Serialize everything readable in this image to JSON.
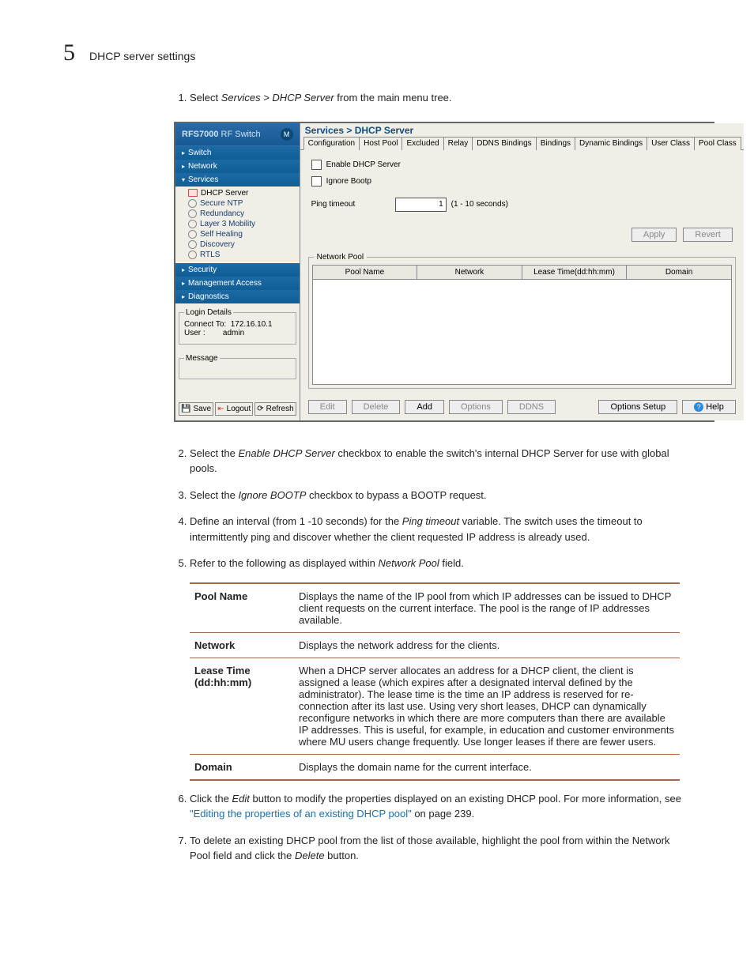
{
  "header": {
    "page_num": "5",
    "title": "DHCP server settings"
  },
  "steps": {
    "s1_pre": "Select ",
    "s1_em": "Services > DHCP Server",
    "s1_post": " from the main menu tree.",
    "s2_pre": "Select the ",
    "s2_em": "Enable DHCP Server",
    "s2_post": " checkbox to enable the switch's internal DHCP Server for use with global pools.",
    "s3_pre": "Select the ",
    "s3_em": "Ignore BOOTP",
    "s3_post": " checkbox to bypass a BOOTP request.",
    "s4_pre": "Define an interval (from 1 -10 seconds) for the ",
    "s4_em": "Ping timeout",
    "s4_post": " variable. The switch uses the timeout to intermittently ping and discover whether the client requested IP address is already used.",
    "s5_pre": "Refer to the following as displayed within ",
    "s5_em": "Network Pool",
    "s5_post": " field.",
    "s6_pre": "Click the ",
    "s6_em": "Edit",
    "s6_mid": " button to modify the properties displayed on an existing DHCP pool. For more information, see ",
    "s6_link": "\"Editing the properties of an existing DHCP pool\"",
    "s6_post": " on page 239.",
    "s7_pre": "To delete an existing DHCP pool from the list of those available, highlight the pool from within the Network Pool field and click the ",
    "s7_em": "Delete",
    "s7_post": " button."
  },
  "ui": {
    "brand_a": "RFS7000",
    "brand_b": " RF Switch",
    "nav": {
      "switch": "Switch",
      "network": "Network",
      "services": "Services",
      "dhcp": "DHCP Server",
      "ntp": "Secure NTP",
      "red": "Redundancy",
      "l3": "Layer 3 Mobility",
      "sh": "Self Healing",
      "disc": "Discovery",
      "rtls": "RTLS",
      "security": "Security",
      "mgmt": "Management Access",
      "diag": "Diagnostics"
    },
    "login": {
      "legend": "Login Details",
      "ct_label": "Connect To:",
      "ct_val": "172.16.10.1",
      "u_label": "User :",
      "u_val": "admin"
    },
    "msg_legend": "Message",
    "footer": {
      "save": "Save",
      "logout": "Logout",
      "refresh": "Refresh"
    },
    "bc": "Services > DHCP Server",
    "tabs": [
      "Configuration",
      "Host Pool",
      "Excluded",
      "Relay",
      "DDNS Bindings",
      "Bindings",
      "Dynamic Bindings",
      "User Class",
      "Pool Class"
    ],
    "form": {
      "enable": "Enable DHCP Server",
      "ignore": "Ignore Bootp",
      "ping": "Ping timeout",
      "ping_val": "1",
      "ping_hint": "(1 - 10 seconds)"
    },
    "actions": {
      "apply": "Apply",
      "revert": "Revert"
    },
    "np_legend": "Network Pool",
    "np_cols": [
      "Pool Name",
      "Network",
      "Lease Time(dd:hh:mm)",
      "Domain"
    ],
    "np_btns": {
      "edit": "Edit",
      "delete": "Delete",
      "add": "Add",
      "options": "Options",
      "ddns": "DDNS",
      "osetup": "Options Setup",
      "help": "Help"
    }
  },
  "table": {
    "r1k": "Pool Name",
    "r1v": "Displays the name of the IP pool from which IP addresses can be issued to DHCP client requests on the current interface. The pool is the range of IP addresses available.",
    "r2k": "Network",
    "r2v": "Displays the network address for the clients.",
    "r3k": "Lease Time (dd:hh:mm)",
    "r3v": "When a DHCP server allocates an address for a DHCP client, the client is assigned a lease (which expires after a designated interval defined by the administrator). The lease time is the time an IP address is reserved for re-connection after its last use. Using very short leases, DHCP can dynamically reconfigure networks in which there are more computers than there are available IP addresses. This is useful, for example, in education and customer environments where MU users change frequently. Use longer leases if there are fewer users.",
    "r4k": "Domain",
    "r4v": "Displays the domain name for the current interface."
  }
}
